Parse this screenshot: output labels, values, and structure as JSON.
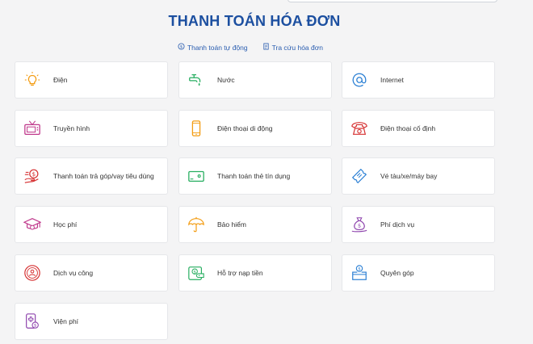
{
  "page": {
    "title": "THANH TOÁN HÓA ĐƠN",
    "links": [
      {
        "label": "Thanh toán tự động",
        "icon": "refresh-dollar-icon"
      },
      {
        "label": "Tra cứu hóa đơn",
        "icon": "document-icon"
      }
    ]
  },
  "services": [
    {
      "label": "Điện",
      "icon": "lightbulb-icon",
      "color": "#f39c12"
    },
    {
      "label": "Nước",
      "icon": "water-tap-icon",
      "color": "#27ae60"
    },
    {
      "label": "Internet",
      "icon": "at-sign-icon",
      "color": "#2a7fd4"
    },
    {
      "label": "Truyền hình",
      "icon": "tv-icon",
      "color": "#c0398c"
    },
    {
      "label": "Điện thoại di động",
      "icon": "mobile-phone-icon",
      "color": "#f39c12"
    },
    {
      "label": "Điện thoại cố định",
      "icon": "landline-phone-icon",
      "color": "#d63031"
    },
    {
      "label": "Thanh toán trả góp/vay tiêu dùng",
      "icon": "loan-hand-icon",
      "color": "#d63031"
    },
    {
      "label": "Thanh toán thẻ tín dụng",
      "icon": "credit-card-icon",
      "color": "#27ae60"
    },
    {
      "label": "Vé tàu/xe/máy bay",
      "icon": "ticket-icon",
      "color": "#2a7fd4"
    },
    {
      "label": "Học phí",
      "icon": "graduation-cap-icon",
      "color": "#c0398c"
    },
    {
      "label": "Bảo hiểm",
      "icon": "umbrella-icon",
      "color": "#f39c12"
    },
    {
      "label": "Phí dịch vụ",
      "icon": "money-bag-icon",
      "color": "#8e44ad"
    },
    {
      "label": "Dịch vụ công",
      "icon": "public-service-icon",
      "color": "#d63031"
    },
    {
      "label": "Hỗ trợ nạp tiền",
      "icon": "wallet-topup-icon",
      "color": "#27ae60"
    },
    {
      "label": "Quyên góp",
      "icon": "donation-box-icon",
      "color": "#2a7fd4"
    },
    {
      "label": "Viện phí",
      "icon": "hospital-bill-icon",
      "color": "#8e44ad"
    }
  ]
}
